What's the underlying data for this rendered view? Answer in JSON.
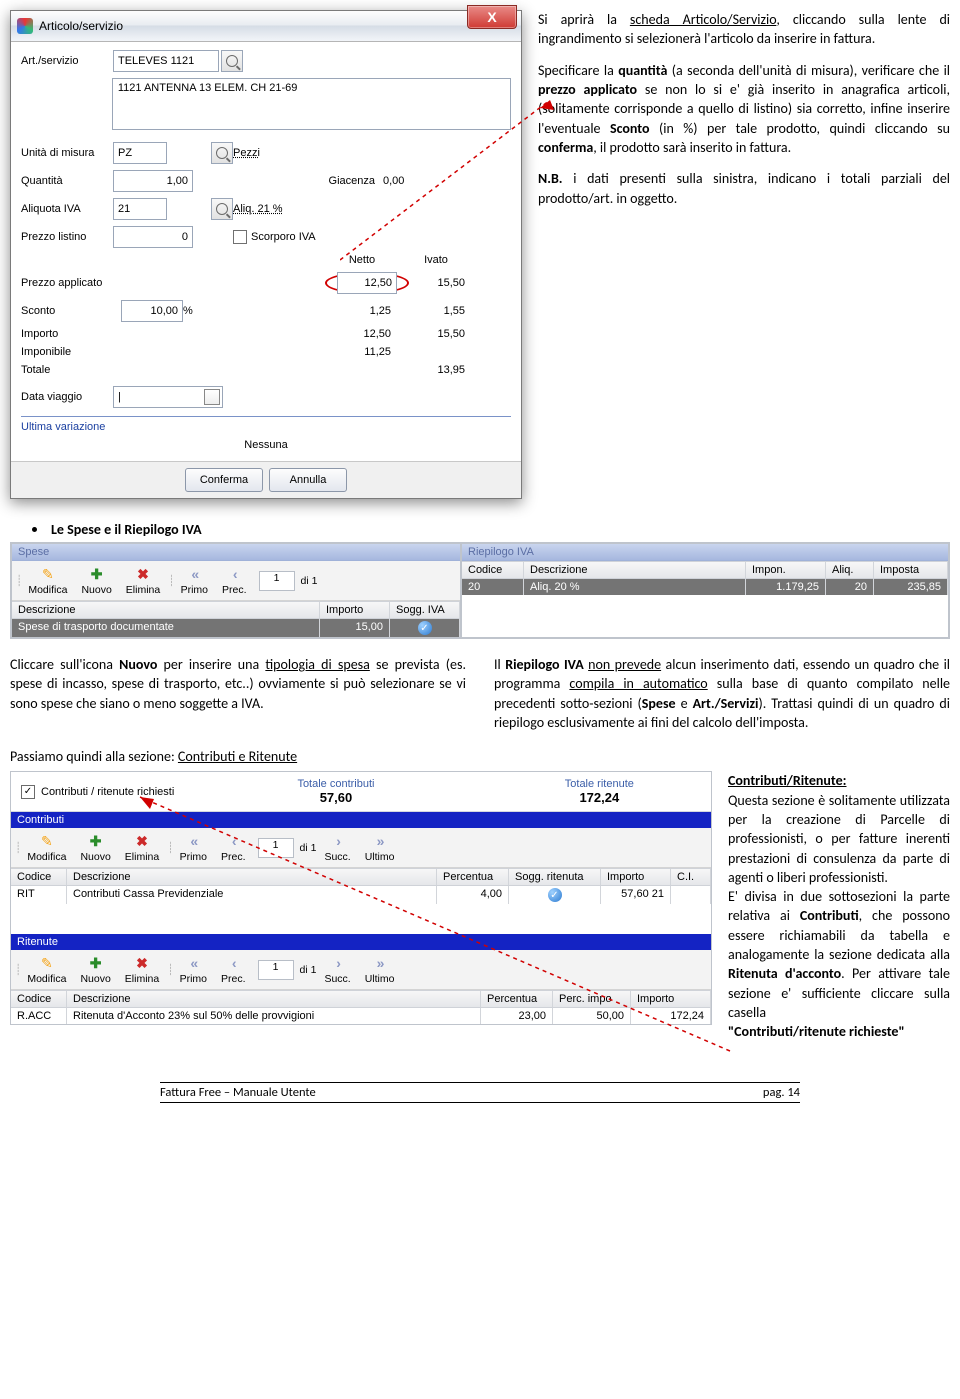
{
  "dialog": {
    "title": "Articolo/servizio",
    "art_label": "Art./servizio",
    "art_code": "TELEVES 1121",
    "art_desc": "1121 ANTENNA 13 ELEM. CH 21-69",
    "rows": {
      "um_label": "Unità di misura",
      "um_val": "PZ",
      "um_desc": "Pezzi",
      "qta_label": "Quantità",
      "qta_val": "1,00",
      "giac_label": "Giacenza",
      "giac_val": "0,00",
      "iva_label": "Aliquota IVA",
      "iva_val": "21",
      "iva_desc": "Aliq. 21 %",
      "plist_label": "Prezzo listino",
      "plist_val": "0",
      "scorporo": "Scorporo IVA",
      "netto": "Netto",
      "ivato": "Ivato",
      "papp_label": "Prezzo applicato",
      "papp_netto": "12,50",
      "papp_ivato": "15,50",
      "sconto_label": "Sconto",
      "sconto_val": "10,00",
      "percent": "%",
      "sconto_netto": "1,25",
      "sconto_ivato": "1,55",
      "importo_label": "Importo",
      "importo_netto": "12,50",
      "importo_ivato": "15,50",
      "impon_label": "Imponibile",
      "impon_val": "11,25",
      "totale_label": "Totale",
      "totale_val": "13,95",
      "data_label": "Data viaggio",
      "data_val": "|"
    },
    "ultima_label": "Ultima variazione",
    "nessuna": "Nessuna",
    "btn_ok": "Conferma",
    "btn_cancel": "Annulla"
  },
  "desc": {
    "p1a": "Si aprirà la ",
    "p1b": "scheda Articolo/Servizio",
    "p1c": ", cliccando sulla lente di ingrandimento si selezionerà l'articolo da inserire in fattura.",
    "p2a": "Specificare la ",
    "p2b": "quantità",
    "p2c": " (a seconda dell'unità di misura), verificare che il ",
    "p2d": "prezzo applicato",
    "p2e": " se non lo si e' già inserito in anagrafica articoli, (solitamente corrisponde a quello di listino) sia corretto, infine inserire l'eventuale ",
    "p2f": "Sconto",
    "p2g": " (in %) per tale prodotto, quindi cliccando su ",
    "p2h": "conferma",
    "p2i": ", il prodotto sarà inserito in fattura.",
    "p3a": "N.B.",
    "p3b": " i dati presenti sulla sinistra, indicano i totali parziali del prodotto/art. in oggetto."
  },
  "section1": "Le Spese  e il Riepilogo IVA",
  "spese": {
    "title": "Spese",
    "tb": {
      "mod": "Modifica",
      "new": "Nuovo",
      "del": "Elimina",
      "primo": "Primo",
      "prec": "Prec.",
      "page": "1",
      "di": "di 1"
    },
    "h1": "Descrizione",
    "h2": "Importo",
    "h3": "Sogg. IVA",
    "r1c1": "Spese di trasporto documentate",
    "r1c2": "15,00"
  },
  "riep": {
    "title": "Riepilogo IVA",
    "h1": "Codice",
    "h2": "Descrizione",
    "h3": "Impon.",
    "h4": "Aliq.",
    "h5": "Imposta",
    "r1c1": "20",
    "r1c2": "Aliq. 20 %",
    "r1c3": "1.179,25",
    "r1c4": "20",
    "r1c5": "235,85"
  },
  "twocol": {
    "left1": "Cliccare sull'icona ",
    "left2": "Nuovo",
    "left3": " per inserire una ",
    "left4": "tipologia di spesa",
    "left5": " se prevista (es. spese di incasso, spese di trasporto, etc..) ovviamente si può selezionare se vi sono spese che siano o meno soggette a IVA.",
    "right1": "Il ",
    "right2": "Riepilogo IVA ",
    "right3": "non prevede",
    "right4": " alcun inserimento dati, essendo un quadro che il programma ",
    "right5": "compila in automatico",
    "right6": " sulla base di quanto compilato nelle precedenti sotto-sezioni (",
    "right7": "Spese",
    "right8": " e ",
    "right9": "Art./Servizi",
    "right10": "). Trattasi quindi di un quadro di riepilogo esclusivamente ai fini del calcolo dell'imposta."
  },
  "passiamo1": "Passiamo quindi alla sezione: ",
  "passiamo2": "Contributi e Ritenute",
  "contrib": {
    "chk": "Contributi / ritenute richiesti",
    "totc_l": "Totale contributi",
    "totc_v": "57,60",
    "totr_l": "Totale ritenute",
    "totr_v": "172,24",
    "bar1": "Contributi",
    "tb": {
      "mod": "Modifica",
      "new": "Nuovo",
      "del": "Elimina",
      "primo": "Primo",
      "prec": "Prec.",
      "page": "1",
      "di": "di 1",
      "succ": "Succ.",
      "ultimo": "Ultimo"
    },
    "h1": "Codice",
    "h2": "Descrizione",
    "h3": "Percentua",
    "h4": "Sogg. ritenuta",
    "h5": "Importo",
    "h6": "C.I.",
    "r1c1": "RIT",
    "r1c2": "Contributi Cassa Previdenziale",
    "r1c3": "4,00",
    "r1c5": "57,60",
    "r1c5b": "21",
    "bar2": "Ritenute",
    "rh1": "Codice",
    "rh2": "Descrizione",
    "rh3": "Percentua",
    "rh4": "Perc. impo",
    "rh5": "Importo",
    "rr1": "R.ACC",
    "rr2": "Ritenuta d'Acconto 23% sul 50% delle provvigioni",
    "rr3": "23,00",
    "rr4": "50,00",
    "rr5": "172,24"
  },
  "side": {
    "h": "Contributi/Ritenute:",
    "p1": "Questa sezione è solitamente utilizzata per la creazione di Parcelle di professionisti, o per fatture inerenti prestazioni di consulenza da parte di agenti o liberi professionisti.",
    "p2a": "E' divisa in due sottosezioni la parte relativa ai ",
    "p2b": "Contributi",
    "p2c": ", che possono essere richiamabili da tabella e analogamente la sezione dedicata alla ",
    "p2d": "Ritenuta d'acconto",
    "p2e": ". Per attivare tale sezione e' sufficiente cliccare sulla casella",
    "p3": "\"Contributi/ritenute richieste\""
  },
  "footer": {
    "left": "Fattura Free – Manuale Utente",
    "right": "pag. 14"
  }
}
